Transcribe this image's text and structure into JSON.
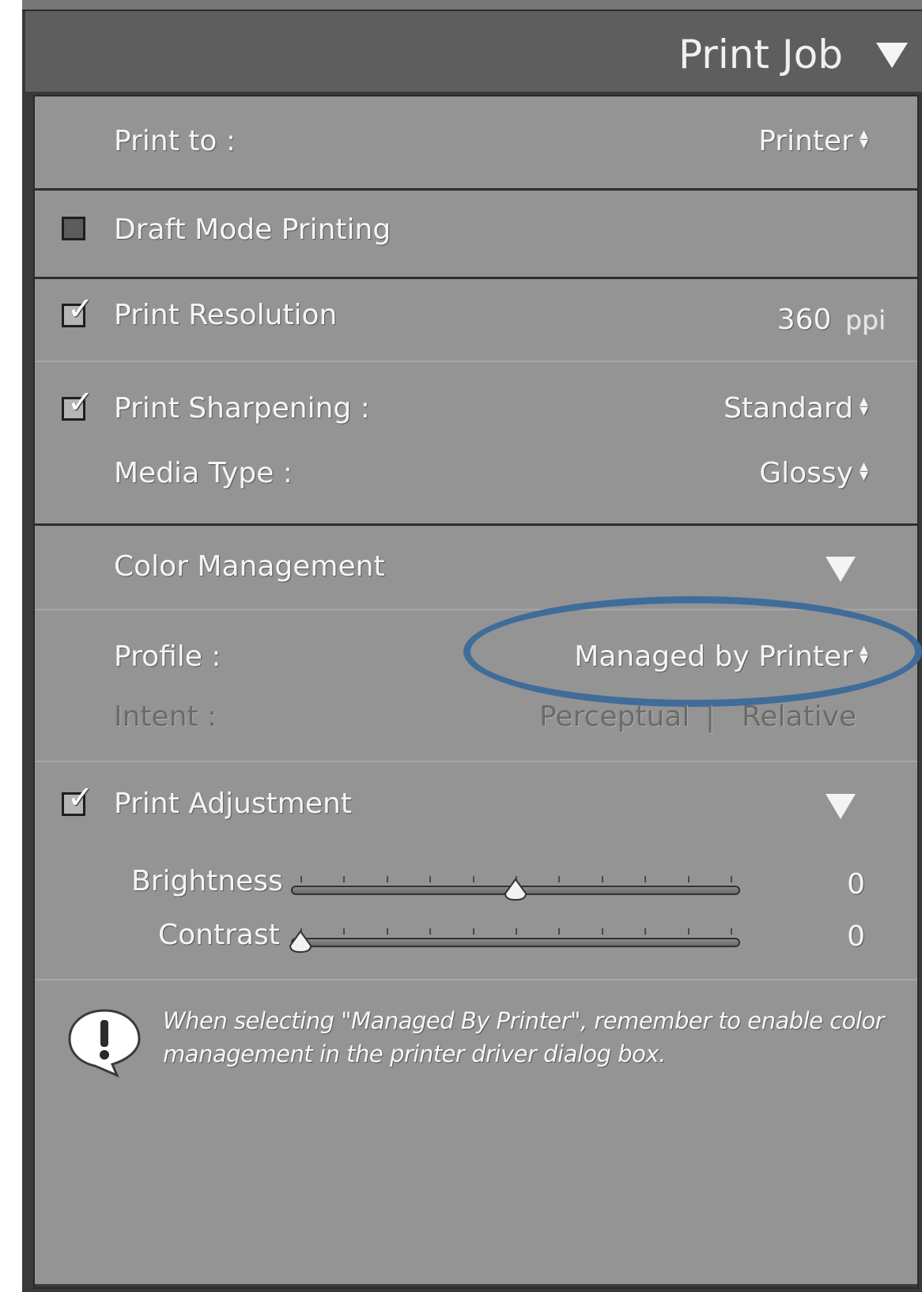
{
  "panel": {
    "title": "Print Job"
  },
  "print_to": {
    "label": "Print to :",
    "value": "Printer"
  },
  "draft_mode": {
    "label": "Draft Mode Printing",
    "checked": false
  },
  "resolution": {
    "label": "Print Resolution",
    "checked": true,
    "value": "360",
    "unit": "ppi"
  },
  "sharpening": {
    "label": "Print Sharpening :",
    "checked": true,
    "value": "Standard"
  },
  "media_type": {
    "label": "Media Type :",
    "value": "Glossy"
  },
  "color_management": {
    "label": "Color Management",
    "profile_label": "Profile :",
    "profile_value": "Managed by Printer",
    "intent_label": "Intent :",
    "intent_option_1": "Perceptual",
    "intent_separator": "|",
    "intent_option_2": "Relative",
    "highlight_color": "#406c9a"
  },
  "print_adjustment": {
    "label": "Print Adjustment",
    "checked": true,
    "brightness_label": "Brightness",
    "brightness_value": "0",
    "brightness_level": 0.5,
    "contrast_label": "Contrast",
    "contrast_value": "0",
    "contrast_level": 0.0
  },
  "note": {
    "icon": "exclamation-speech-bubble-icon",
    "line1": "When selecting \"Managed By Printer\", remember to enable color",
    "line2": "management in the printer driver dialog box."
  },
  "colors": {
    "panel_background": "#949494",
    "header_background": "#5e5e5e",
    "text": "#f5f5f5"
  }
}
